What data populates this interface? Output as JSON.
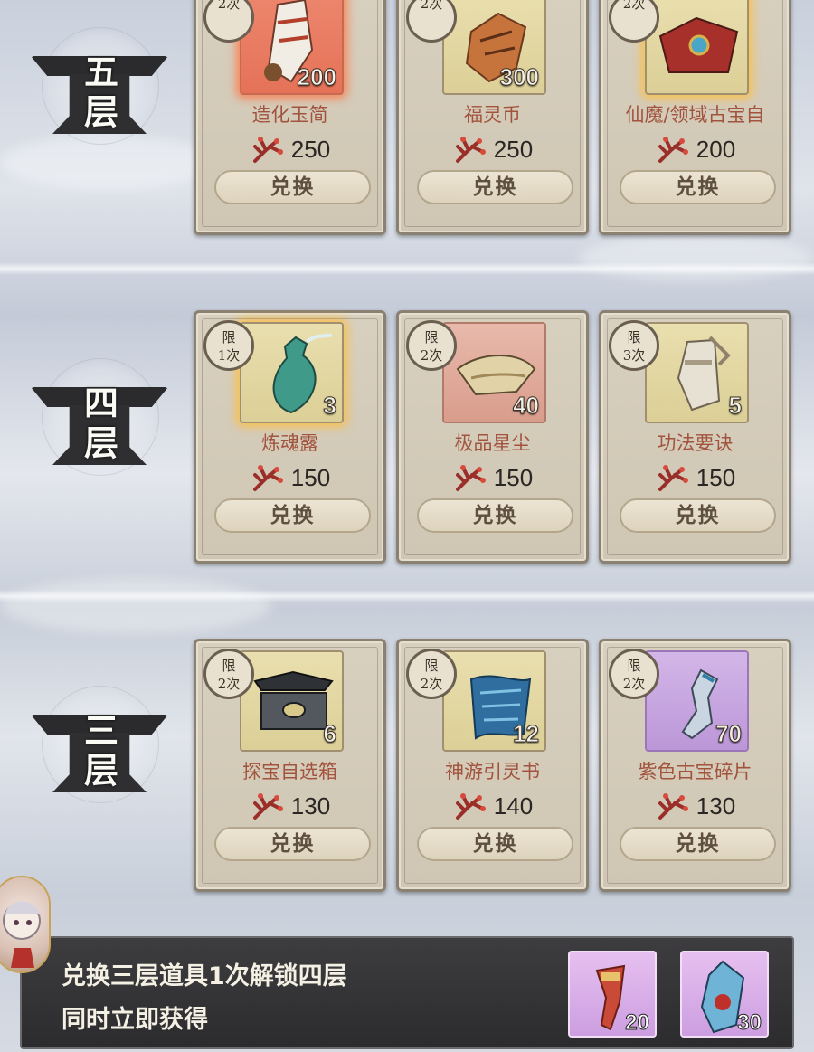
{
  "floors": [
    {
      "label": "五层",
      "items": [
        {
          "limit_text": "",
          "limit_count": "2次",
          "qty": "200",
          "name": "造化玉简",
          "price": "250",
          "redeem": "兑换",
          "frame": "red",
          "icon": "jade-slip-icon"
        },
        {
          "limit_text": "",
          "limit_count": "2次",
          "qty": "300",
          "name": "福灵币",
          "price": "250",
          "redeem": "兑换",
          "frame": "gold",
          "icon": "coin-icon"
        },
        {
          "limit_text": "",
          "limit_count": "2次",
          "qty": "",
          "name": "仙魔/领域古宝自",
          "price": "200",
          "redeem": "兑换",
          "frame": "gold-glow",
          "icon": "treasure-chest-icon"
        }
      ]
    },
    {
      "label": "四层",
      "items": [
        {
          "limit_text": "限",
          "limit_count": "1次",
          "qty": "3",
          "name": "炼魂露",
          "price": "150",
          "redeem": "兑换",
          "frame": "gold-glow",
          "icon": "vase-icon"
        },
        {
          "limit_text": "限",
          "limit_count": "2次",
          "qty": "40",
          "name": "极品星尘",
          "price": "150",
          "redeem": "兑换",
          "frame": "pink",
          "icon": "stardust-bowl-icon"
        },
        {
          "limit_text": "限",
          "limit_count": "3次",
          "qty": "5",
          "name": "功法要诀",
          "price": "150",
          "redeem": "兑换",
          "frame": "gold",
          "icon": "scroll-icon"
        }
      ]
    },
    {
      "label": "三层",
      "items": [
        {
          "limit_text": "限",
          "limit_count": "2次",
          "qty": "6",
          "name": "探宝自选箱",
          "price": "130",
          "redeem": "兑换",
          "frame": "gold",
          "icon": "box-icon"
        },
        {
          "limit_text": "限",
          "limit_count": "2次",
          "qty": "12",
          "name": "神游引灵书",
          "price": "140",
          "redeem": "兑换",
          "frame": "gold",
          "icon": "blue-scroll-icon"
        },
        {
          "limit_text": "限",
          "limit_count": "2次",
          "qty": "70",
          "name": "紫色古宝碎片",
          "price": "130",
          "redeem": "兑换",
          "frame": "purple",
          "icon": "blade-fragment-icon"
        }
      ]
    }
  ],
  "bottom": {
    "line1": "兑换三层道具1次解锁四层",
    "line2": "同时立即获得",
    "rewards": [
      {
        "qty": "20",
        "icon": "red-talisman-icon"
      },
      {
        "qty": "30",
        "icon": "blue-crystal-icon"
      }
    ]
  },
  "currency_icon": "coral-branch-icon",
  "colors": {
    "item_name": "#a2533d",
    "card_bg": "#d8d0bf",
    "bar_bg": "#2c2c2e"
  }
}
